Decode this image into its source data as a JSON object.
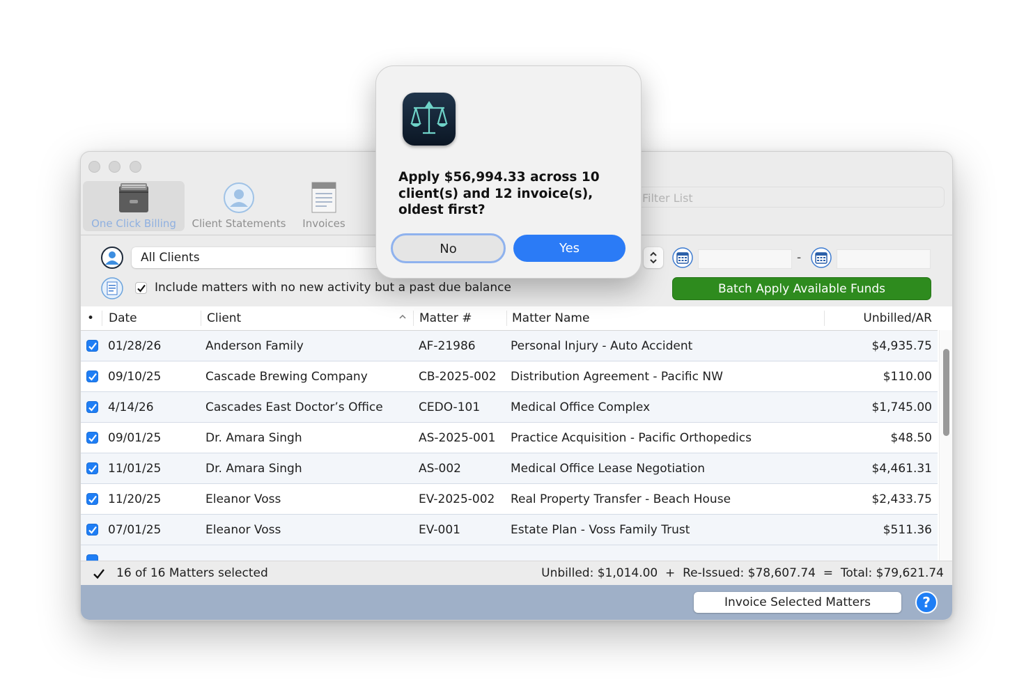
{
  "toolbar": {
    "items": [
      {
        "label": "One Click Billing",
        "icon": "file-box-icon",
        "active": true
      },
      {
        "label": "Client Statements",
        "icon": "person-circle-icon",
        "active": false
      },
      {
        "label": "Invoices",
        "icon": "invoice-doc-icon",
        "active": false
      }
    ],
    "filter_placeholder": "Filter List"
  },
  "filters": {
    "client_select": "All Clients",
    "include_label": "Include matters with no new activity but a past due balance",
    "include_checked": true,
    "date_separator": "-",
    "batch_button": "Batch Apply Available Funds"
  },
  "table": {
    "columns": {
      "dot": "•",
      "date": "Date",
      "client": "Client",
      "matter_no": "Matter #",
      "matter_name": "Matter Name",
      "amount": "Unbilled/AR"
    },
    "rows": [
      {
        "date": "01/28/26",
        "client": "Anderson Family",
        "matter_no": "AF-21986",
        "matter_name": "Personal Injury - Auto Accident",
        "amount": "$4,935.75"
      },
      {
        "date": "09/10/25",
        "client": "Cascade Brewing Company",
        "matter_no": "CB-2025-002",
        "matter_name": "Distribution Agreement - Pacific NW",
        "amount": "$110.00"
      },
      {
        "date": "4/14/26",
        "client": "Cascades East Doctor’s Office",
        "matter_no": "CEDO-101",
        "matter_name": "Medical Office Complex",
        "amount": "$1,745.00"
      },
      {
        "date": "09/01/25",
        "client": "Dr. Amara Singh",
        "matter_no": "AS-2025-001",
        "matter_name": "Practice Acquisition - Pacific Orthopedics",
        "amount": "$48.50"
      },
      {
        "date": "11/01/25",
        "client": "Dr. Amara Singh",
        "matter_no": "AS-002",
        "matter_name": "Medical Office Lease Negotiation",
        "amount": "$4,461.31"
      },
      {
        "date": "11/20/25",
        "client": "Eleanor Voss",
        "matter_no": "EV-2025-002",
        "matter_name": "Real Property Transfer - Beach House",
        "amount": "$2,433.75"
      },
      {
        "date": "07/01/25",
        "client": "Eleanor Voss",
        "matter_no": "EV-001",
        "matter_name": "Estate Plan - Voss Family Trust",
        "amount": "$511.36"
      }
    ]
  },
  "footer": {
    "selected": "16 of 16 Matters selected",
    "totals": "Unbilled: $1,014.00  +  Re-Issued: $78,607.74  =  Total: $79,621.74"
  },
  "bottom": {
    "invoice_button": "Invoice Selected Matters",
    "help": "?"
  },
  "alert": {
    "message": "Apply $56,994.33 across 10 client(s) and 12 invoice(s), oldest first?",
    "no_label": "No",
    "yes_label": "Yes",
    "icon": "scales-of-justice-icon"
  },
  "colors": {
    "accent": "#1f7ef5",
    "batch_green": "#2e8b1e",
    "bottom_bar": "#9fb0c8"
  }
}
